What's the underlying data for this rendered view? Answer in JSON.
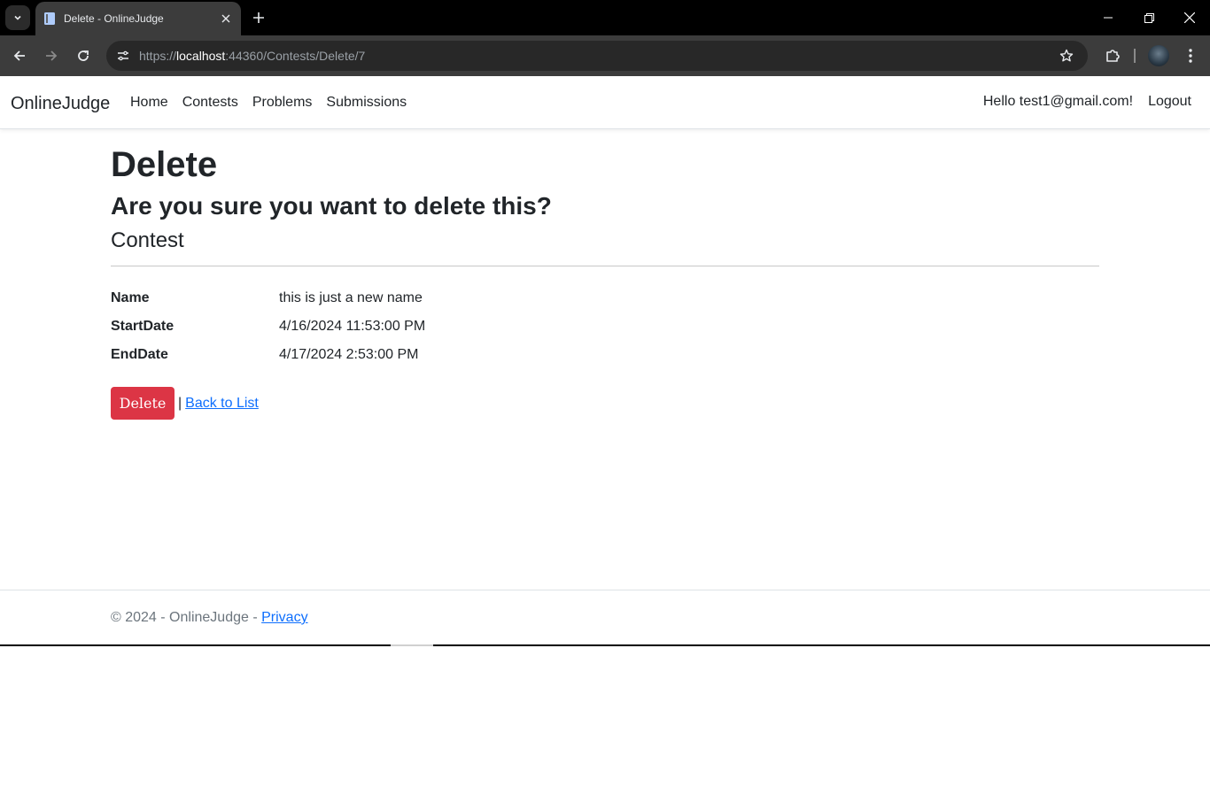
{
  "browser": {
    "tab_title": "Delete - OnlineJudge",
    "url_scheme": "https://",
    "url_host": "localhost",
    "url_rest": ":44360/Contests/Delete/7"
  },
  "navbar": {
    "brand": "OnlineJudge",
    "links": [
      "Home",
      "Contests",
      "Problems",
      "Submissions"
    ],
    "greeting": "Hello test1@gmail.com!",
    "logout": "Logout"
  },
  "page": {
    "title": "Delete",
    "question": "Are you sure you want to delete this?",
    "entity": "Contest",
    "fields": [
      {
        "label": "Name",
        "value": "this is just a new name"
      },
      {
        "label": "StartDate",
        "value": "4/16/2024 11:53:00 PM"
      },
      {
        "label": "EndDate",
        "value": "4/17/2024 2:53:00 PM"
      }
    ],
    "delete_label": "Delete",
    "separator": "|",
    "back_label": "Back to List"
  },
  "footer": {
    "copyright": "© 2024 - OnlineJudge -",
    "privacy": "Privacy"
  },
  "colors": {
    "danger": "#dc3545",
    "link": "#0d6efd"
  }
}
